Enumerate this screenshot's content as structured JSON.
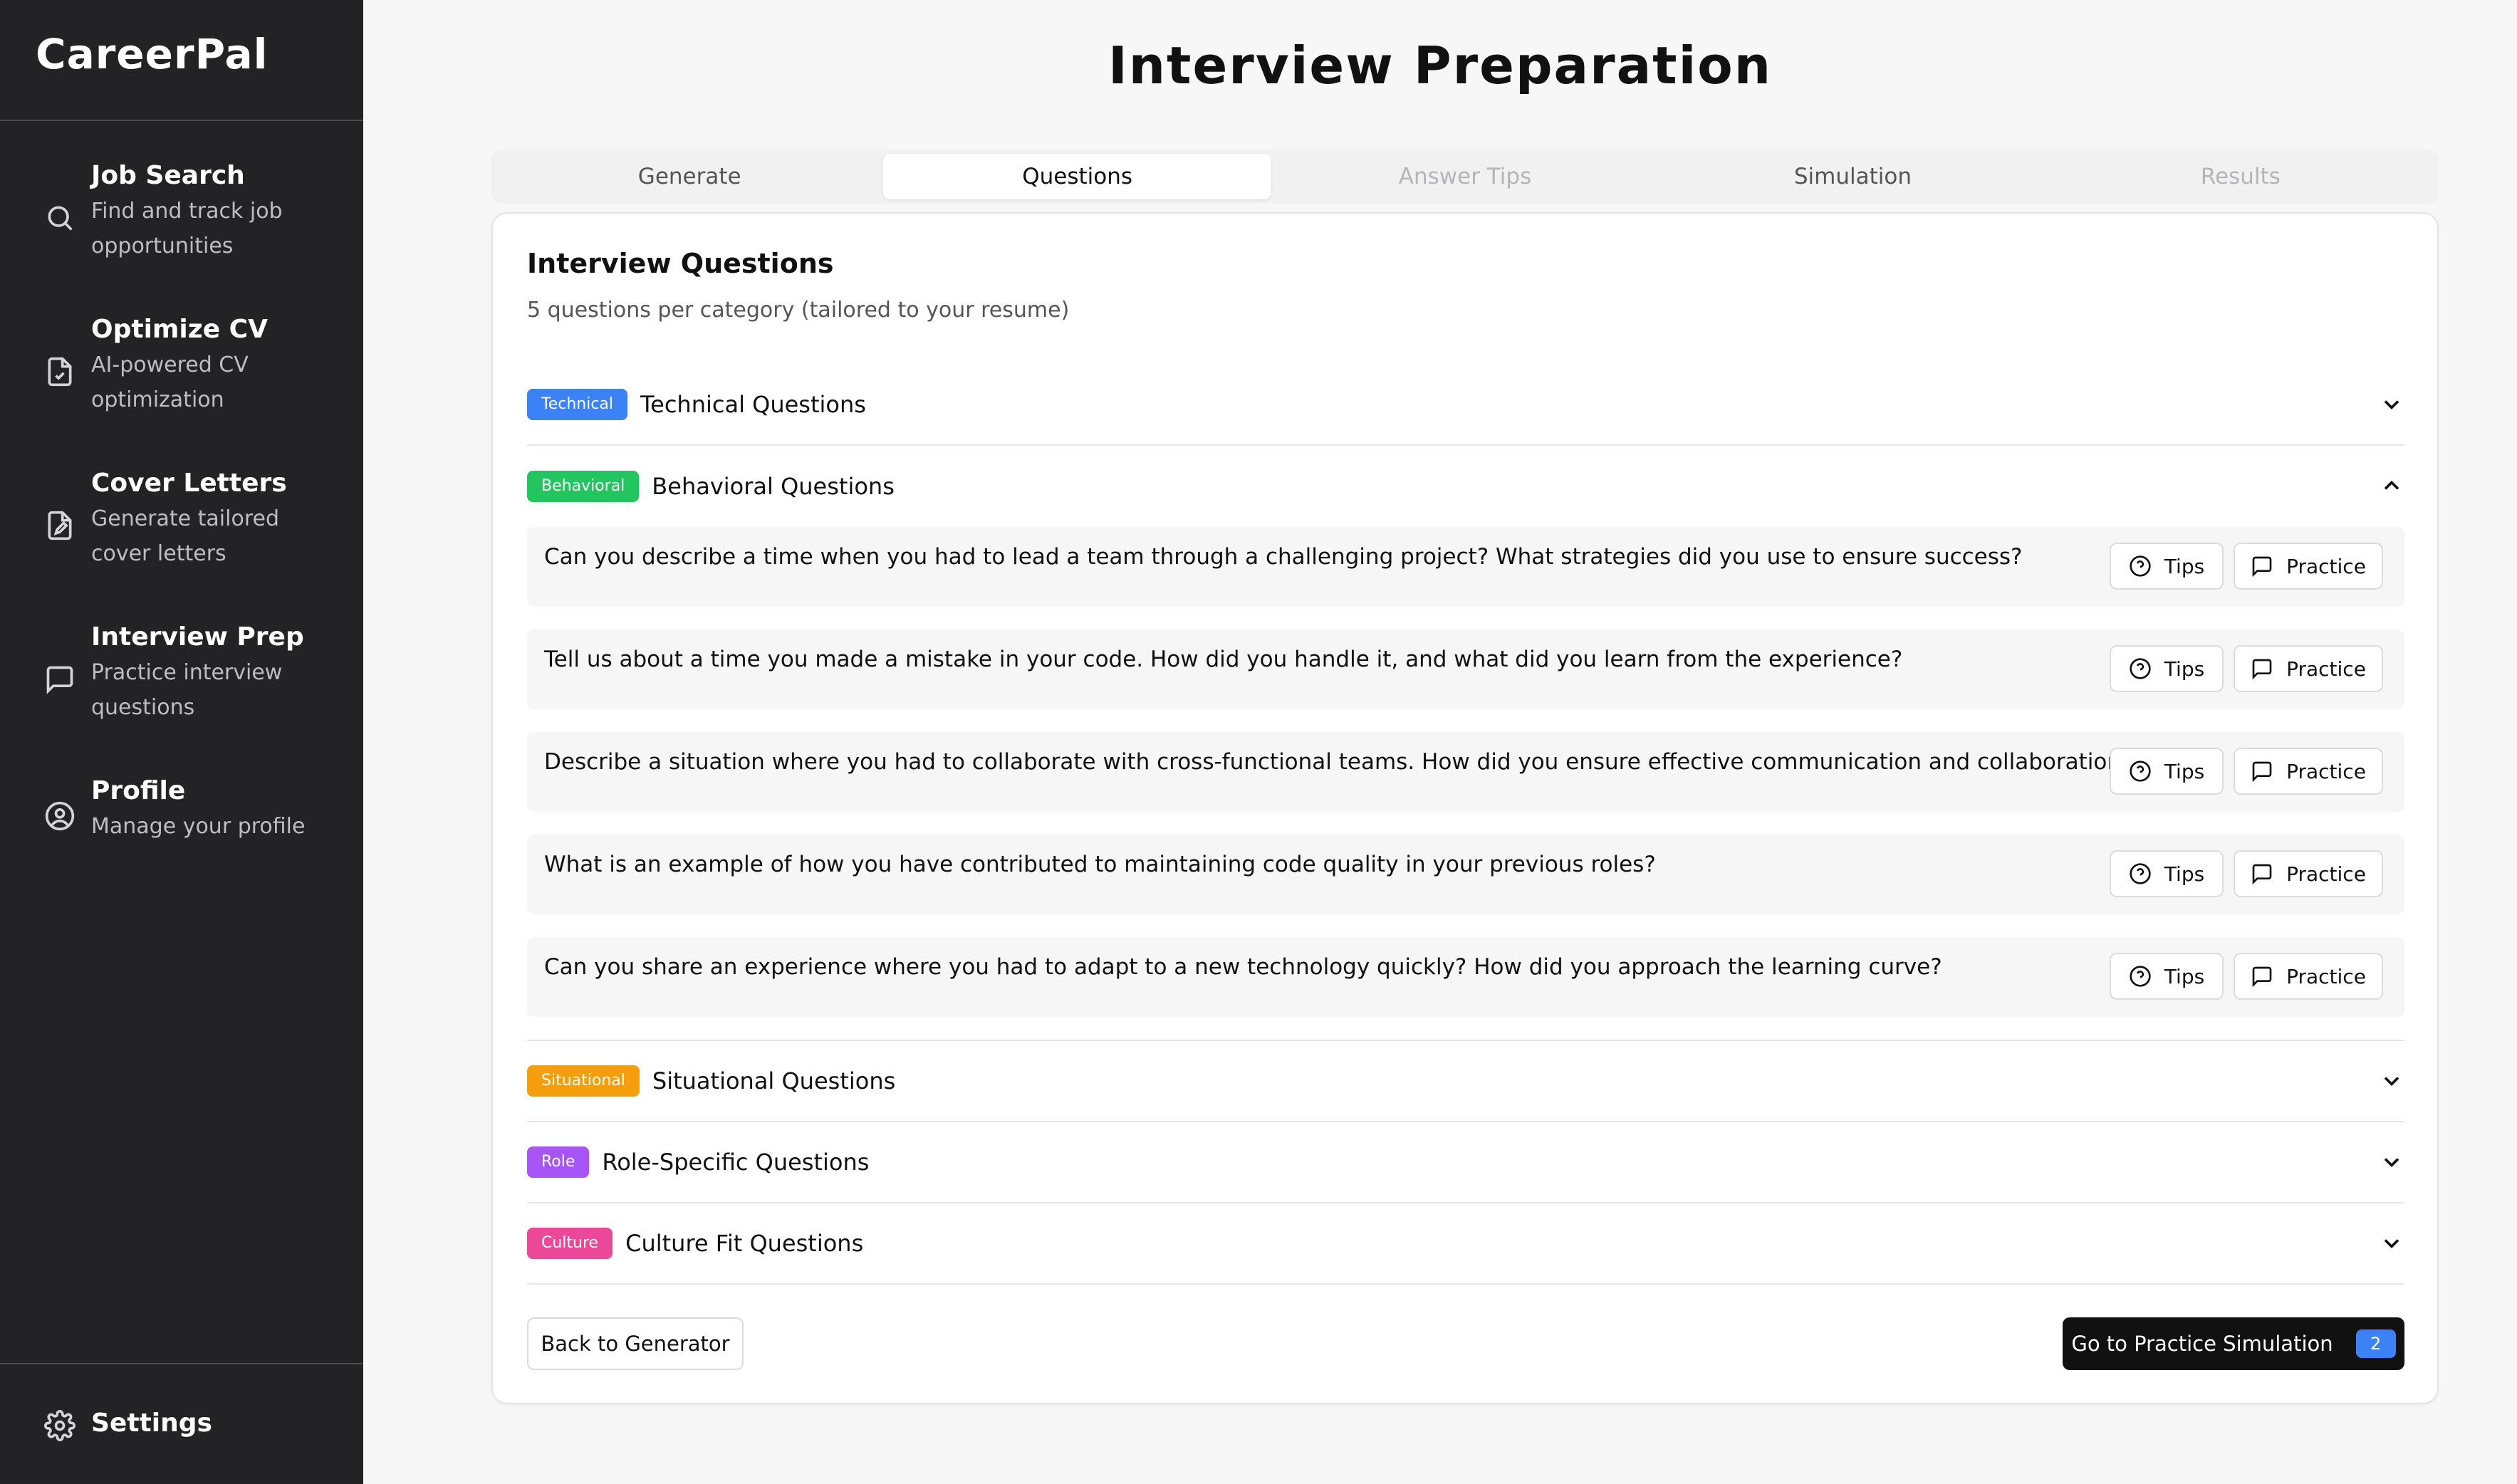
{
  "app": {
    "name": "CareerPal"
  },
  "sidebar": {
    "items": [
      {
        "title": "Job Search",
        "desc_line1": "Find and track job",
        "desc_line2": "opportunities",
        "icon": "search-icon"
      },
      {
        "title": "Optimize CV",
        "desc_line1": "AI-powered CV",
        "desc_line2": "optimization",
        "icon": "document-check-icon"
      },
      {
        "title": "Cover Letters",
        "desc_line1": "Generate tailored",
        "desc_line2": "cover letters",
        "icon": "document-edit-icon"
      },
      {
        "title": "Interview Prep",
        "desc_line1": "Practice interview",
        "desc_line2": "questions",
        "icon": "message-square-icon"
      },
      {
        "title": "Profile",
        "desc_line1": "Manage your profile",
        "desc_line2": "",
        "icon": "user-circle-icon"
      }
    ],
    "settings_label": "Settings"
  },
  "page": {
    "title": "Interview Preparation"
  },
  "tabs": [
    {
      "label": "Generate",
      "state": "normal"
    },
    {
      "label": "Questions",
      "state": "active"
    },
    {
      "label": "Answer Tips",
      "state": "disabled"
    },
    {
      "label": "Simulation",
      "state": "normal"
    },
    {
      "label": "Results",
      "state": "disabled"
    }
  ],
  "card": {
    "title": "Interview Questions",
    "subtitle": "5 questions per category (tailored to your resume)"
  },
  "categories": [
    {
      "badge": "Technical",
      "title": "Technical Questions",
      "color": "#3b82f6",
      "expanded": false
    },
    {
      "badge": "Behavioral",
      "title": "Behavioral Questions",
      "color": "#22c55e",
      "expanded": true
    },
    {
      "badge": "Situational",
      "title": "Situational Questions",
      "color": "#f59e0b",
      "expanded": false
    },
    {
      "badge": "Role",
      "title": "Role-Specific Questions",
      "color": "#a855f7",
      "expanded": false
    },
    {
      "badge": "Culture",
      "title": "Culture Fit Questions",
      "color": "#ec4899",
      "expanded": false
    }
  ],
  "questions": [
    {
      "text": "Can you describe a time when you had to lead a team through a challenging project? What strategies did you use to ensure success?"
    },
    {
      "text": "Tell us about a time you made a mistake in your code. How did you handle it, and what did you learn from the experience?"
    },
    {
      "text": "Describe a situation where you had to collaborate with cross-functional teams. How did you ensure effective communication and collaboration?"
    },
    {
      "text": "What is an example of how you have contributed to maintaining code quality in your previous roles?"
    },
    {
      "text": "Can you share an experience where you had to adapt to a new technology quickly? How did you approach the learning curve?"
    }
  ],
  "buttons": {
    "tips_label": "Tips",
    "practice_label": "Practice",
    "back_label": "Back to Generator",
    "go_label": "Go to Practice Simulation",
    "go_count": "2"
  }
}
